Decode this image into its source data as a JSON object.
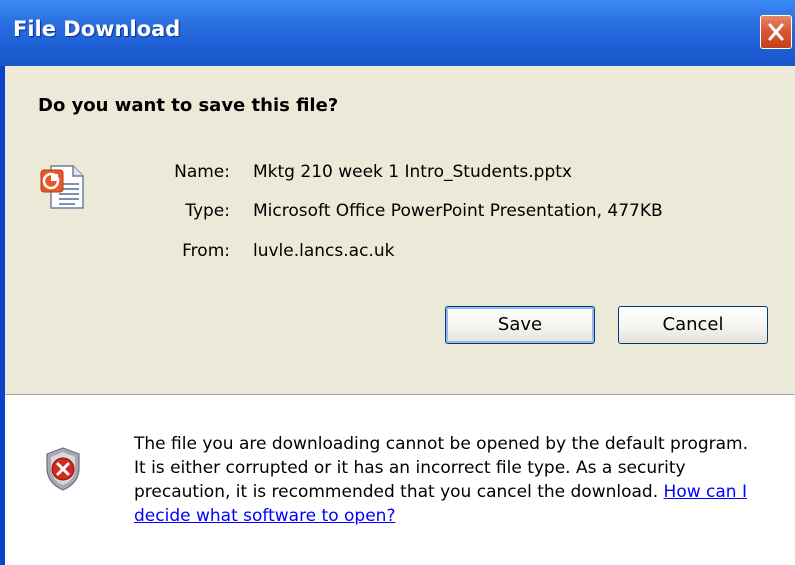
{
  "window": {
    "title": "File Download",
    "close_icon": "close-icon"
  },
  "prompt": {
    "question": "Do you want to save this file?"
  },
  "file": {
    "icon": "powerpoint-file-icon",
    "name_label": "Name:",
    "name_value": "Mktg 210 week 1 Intro_Students.pptx",
    "type_label": "Type:",
    "type_value": "Microsoft Office PowerPoint Presentation, 477KB",
    "from_label": "From:",
    "from_value": "luvle.lancs.ac.uk"
  },
  "buttons": {
    "save": "Save",
    "cancel": "Cancel"
  },
  "warning": {
    "icon": "security-shield-icon",
    "text": "The file you are downloading cannot be opened by the default program. It is either corrupted or it has an incorrect file type. As a security precaution, it is recommended that you cancel the download.",
    "link": "How can I decide what software to open?"
  },
  "colors": {
    "titlebar": "#2a6fe0",
    "dialog_bg": "#ece9d8",
    "close_button": "#d9542f",
    "link": "#0000ff"
  }
}
